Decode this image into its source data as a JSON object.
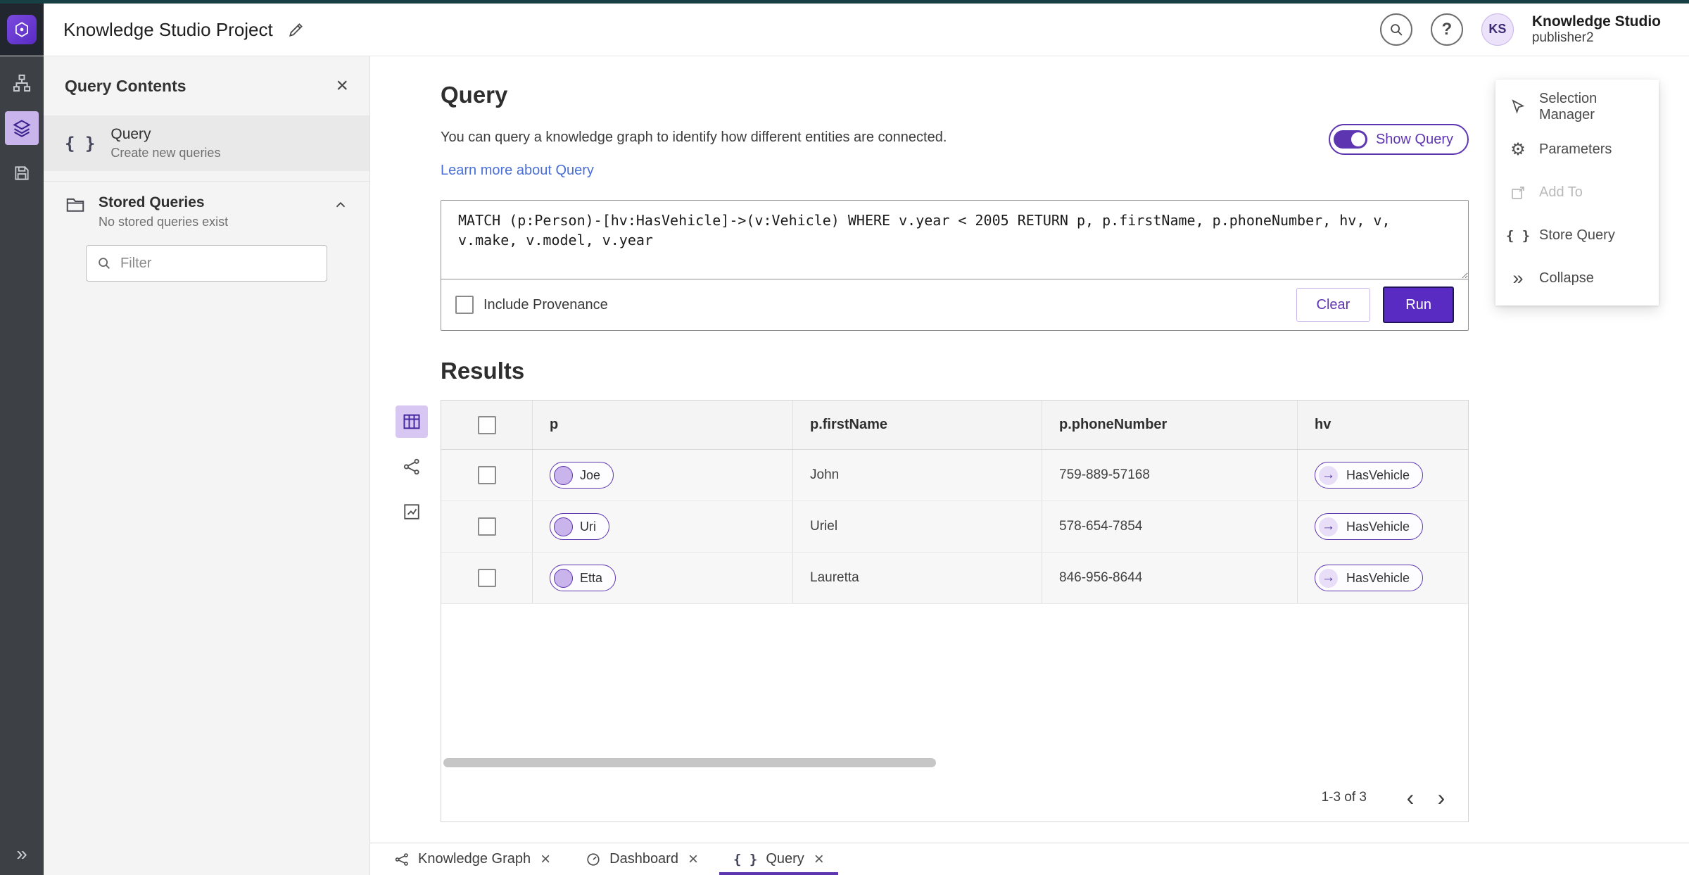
{
  "accent_color": "#5e35b1",
  "header": {
    "project_title": "Knowledge Studio Project",
    "app_name": "Knowledge Studio",
    "user_name": "publisher2",
    "avatar_initials": "KS"
  },
  "sidebar": {
    "title": "Query Contents",
    "query_item": {
      "label": "Query",
      "description": "Create new queries"
    },
    "stored_queries": {
      "label": "Stored Queries",
      "description": "No stored queries exist"
    },
    "filter_placeholder": "Filter"
  },
  "query_panel": {
    "title": "Query",
    "description": "You can query a knowledge graph to identify how different entities are connected.",
    "learn_more_label": "Learn more about Query",
    "show_query_label": "Show Query",
    "show_query_on": true,
    "query_text": "MATCH (p:Person)-[hv:HasVehicle]->(v:Vehicle) WHERE v.year < 2005 RETURN p, p.firstName, p.phoneNumber, hv, v, v.make, v.model, v.year",
    "include_provenance_label": "Include Provenance",
    "clear_label": "Clear",
    "run_label": "Run"
  },
  "results": {
    "title": "Results",
    "columns": [
      "p",
      "p.firstName",
      "p.phoneNumber",
      "hv"
    ],
    "rows": [
      {
        "p": "Joe",
        "firstName": "John",
        "phone": "759-889-57168",
        "hv": "HasVehicle"
      },
      {
        "p": "Uri",
        "firstName": "Uriel",
        "phone": "578-654-7854",
        "hv": "HasVehicle"
      },
      {
        "p": "Etta",
        "firstName": "Lauretta",
        "phone": "846-956-8644",
        "hv": "HasVehicle"
      }
    ],
    "pagination": "1-3 of 3"
  },
  "actions_menu": {
    "selection_manager": "Selection Manager",
    "parameters": "Parameters",
    "add_to": "Add To",
    "store_query": "Store Query",
    "collapse": "Collapse"
  },
  "bottom_tabs": [
    {
      "label": "Knowledge Graph"
    },
    {
      "label": "Dashboard"
    },
    {
      "label": "Query"
    }
  ]
}
